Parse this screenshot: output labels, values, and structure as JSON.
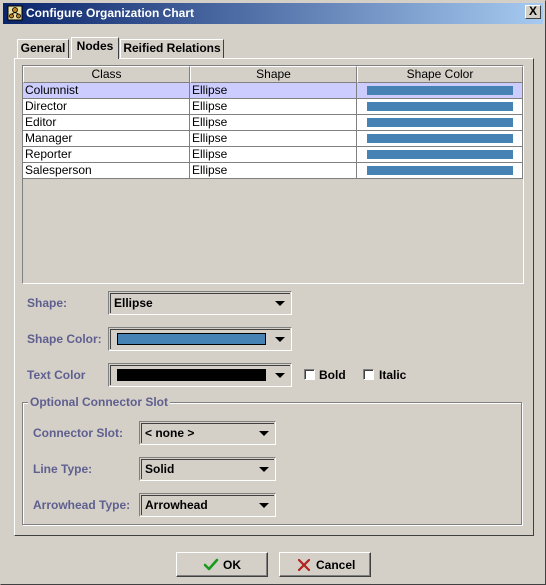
{
  "window": {
    "title": "Configure Organization Chart",
    "close_label": "X"
  },
  "tabs": [
    {
      "label": "General",
      "active": false
    },
    {
      "label": "Nodes",
      "active": true
    },
    {
      "label": "Reified Relations",
      "active": false
    }
  ],
  "table": {
    "columns": [
      "Class",
      "Shape",
      "Shape Color"
    ],
    "rows": [
      {
        "class": "Columnist",
        "shape": "Ellipse",
        "color": "#4682b4",
        "selected": true
      },
      {
        "class": "Director",
        "shape": "Ellipse",
        "color": "#4682b4",
        "selected": false
      },
      {
        "class": "Editor",
        "shape": "Ellipse",
        "color": "#4682b4",
        "selected": false
      },
      {
        "class": "Manager",
        "shape": "Ellipse",
        "color": "#4682b4",
        "selected": false
      },
      {
        "class": "Reporter",
        "shape": "Ellipse",
        "color": "#4682b4",
        "selected": false
      },
      {
        "class": "Salesperson",
        "shape": "Ellipse",
        "color": "#4682b4",
        "selected": false
      }
    ]
  },
  "form": {
    "shape_label": "Shape:",
    "shape_value": "Ellipse",
    "shape_color_label": "Shape Color:",
    "shape_color_value": "#4682b4",
    "text_color_label": "Text Color",
    "text_color_value": "#000000",
    "bold_label": "Bold",
    "bold_checked": false,
    "italic_label": "Italic",
    "italic_checked": false
  },
  "connector": {
    "group_title": "Optional Connector Slot",
    "slot_label": "Connector Slot:",
    "slot_value": "< none >",
    "line_type_label": "Line Type:",
    "line_type_value": "Solid",
    "arrowhead_label": "Arrowhead Type:",
    "arrowhead_value": "Arrowhead"
  },
  "buttons": {
    "ok_label": "OK",
    "cancel_label": "Cancel"
  },
  "colors": {
    "label_text": "#5f5f8f",
    "selected_row": "#ccccff",
    "title_start": "#0a246a",
    "title_end": "#a6caf0"
  },
  "icons": {
    "title": "org-chart-icon",
    "ok": "check-icon",
    "cancel": "x-icon"
  }
}
